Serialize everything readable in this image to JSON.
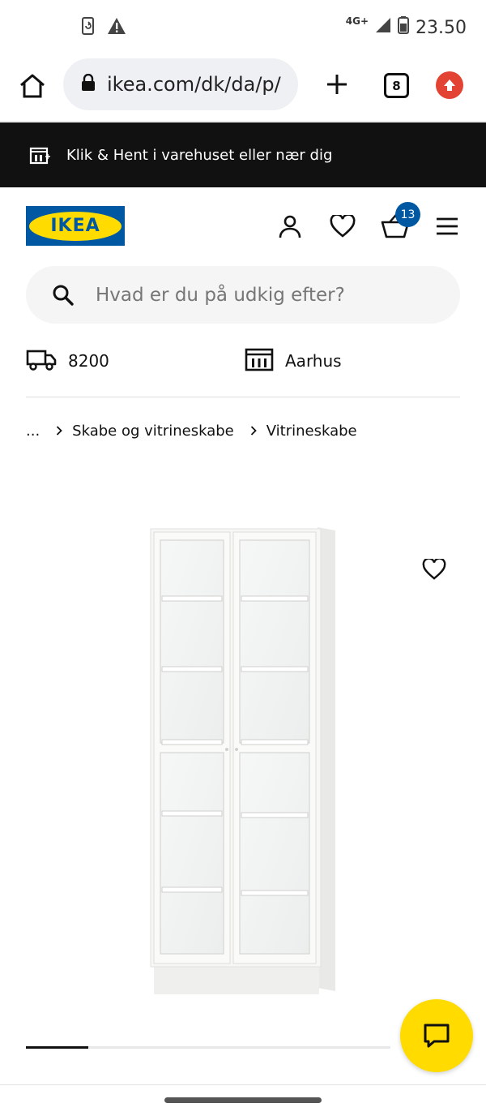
{
  "status_bar": {
    "network": "4G+",
    "time": "23.50",
    "icons": [
      "screen-rotate-icon",
      "warning-icon",
      "signal-icon",
      "battery-icon"
    ]
  },
  "browser": {
    "url": "ikea.com/dk/da/p/",
    "tab_count": "8",
    "icons": [
      "home-icon",
      "lock-icon",
      "plus-icon",
      "tabs-icon",
      "update-icon"
    ],
    "update_color": "#e24333"
  },
  "promo": {
    "text": "Klik & Hent i varehuset eller nær dig",
    "icon": "store-icon"
  },
  "header": {
    "logo_text": "IKEA",
    "cart_count": "13",
    "icons": [
      "profile-icon",
      "heart-icon",
      "cart-icon",
      "menu-icon"
    ],
    "brand_blue": "#0058a3",
    "brand_yellow": "#ffdb00"
  },
  "search": {
    "placeholder": "Hvad er du på udkig efter?"
  },
  "delivery": {
    "postcode": "8200",
    "store": "Aarhus"
  },
  "breadcrumb": {
    "ellipsis": "...",
    "items": [
      "Skabe og vitrineskabe",
      "Vitrineskabe"
    ]
  },
  "product": {
    "image": "white-glass-door-bookcase"
  },
  "carousel": {
    "progress": 0.17
  }
}
